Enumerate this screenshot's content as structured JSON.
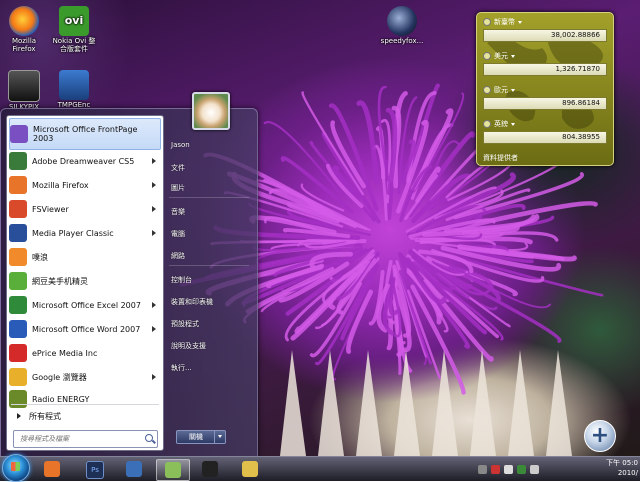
{
  "desktop_icons": [
    {
      "label_line1": "Mozilla",
      "label_line2": "Firefox",
      "icon": "firefox-icon"
    },
    {
      "label_line1": "Nokia Ovi 整",
      "label_line2": "合版套件",
      "badge": "ovi",
      "icon": "nokia-ovi-icon"
    },
    {
      "label_line1": "SILKYPIX",
      "label_line2": "",
      "icon": "silkypix-icon"
    },
    {
      "label_line1": "TMPGEnc",
      "label_line2": "",
      "icon": "tmpgenc-icon"
    },
    {
      "label_line1": "speedyfox...",
      "label_line2": "",
      "icon": "speedyfox-icon"
    }
  ],
  "start_menu": {
    "programs": [
      {
        "label": "Microsoft Office FrontPage 2003",
        "icon": "frontpage-icon",
        "color": "#7a4fc2",
        "has_arrow": false
      },
      {
        "label": "Adobe Dreamweaver CS5",
        "icon": "dreamweaver-icon",
        "color": "#3a7a3a",
        "has_arrow": true
      },
      {
        "label": "Mozilla Firefox",
        "icon": "firefox-icon",
        "color": "#e8742a",
        "has_arrow": true
      },
      {
        "label": "FSViewer",
        "icon": "fsviewer-icon",
        "color": "#d94a2a",
        "has_arrow": true
      },
      {
        "label": "Media Player Classic",
        "icon": "media-player-icon",
        "color": "#2a4f9a",
        "has_arrow": true
      },
      {
        "label": "噗浪",
        "icon": "plurk-icon",
        "color": "#f08a2a",
        "has_arrow": false
      },
      {
        "label": "網豆美手机精灵",
        "icon": "phone-genie-icon",
        "color": "#5aae3a",
        "has_arrow": false
      },
      {
        "label": "Microsoft Office Excel 2007",
        "icon": "excel-icon",
        "color": "#2f8a3a",
        "has_arrow": true
      },
      {
        "label": "Microsoft Office Word 2007",
        "icon": "word-icon",
        "color": "#2b5bb8",
        "has_arrow": true
      },
      {
        "label": "ePrice Media Inc",
        "icon": "eprice-icon",
        "color": "#d42a2a",
        "has_arrow": false
      },
      {
        "label": "Google 瀏覽器",
        "icon": "chrome-icon",
        "color": "#e8b02a",
        "has_arrow": true
      },
      {
        "label": "Radio ENERGY",
        "icon": "radio-energy-icon",
        "color": "#6a8a2a",
        "has_arrow": false
      }
    ],
    "all_programs": "所有程式",
    "search_placeholder": "搜尋程式及檔案",
    "right_links": [
      "Jason",
      "文件",
      "圖片",
      "音樂",
      "電腦",
      "網路",
      "控制台",
      "裝置和印表機",
      "預設程式",
      "說明及支援",
      "執行..."
    ],
    "shutdown_label": "關機"
  },
  "currency_gadget": {
    "rows": [
      {
        "name": "新臺幣",
        "value": "38,002.88866"
      },
      {
        "name": "美元",
        "value": "1,326.71870"
      },
      {
        "name": "歐元",
        "value": "896.86184"
      },
      {
        "name": "英鎊",
        "value": "804.38955"
      }
    ],
    "footer": "資料提供者"
  },
  "taskbar": {
    "buttons": [
      {
        "name": "firefox",
        "icon": "firefox-icon",
        "active": false
      },
      {
        "name": "photoshop",
        "icon": "photoshop-icon",
        "active": false,
        "text": "Ps"
      },
      {
        "name": "windows-live",
        "icon": "live-writer-icon",
        "active": false
      },
      {
        "name": "messenger",
        "icon": "messenger-icon",
        "active": true
      },
      {
        "name": "media",
        "icon": "music-note-icon",
        "active": false
      },
      {
        "name": "explorer",
        "icon": "folder-icon",
        "active": false
      }
    ],
    "clock_line1": "下午 05:0",
    "clock_line2": "2010/"
  }
}
